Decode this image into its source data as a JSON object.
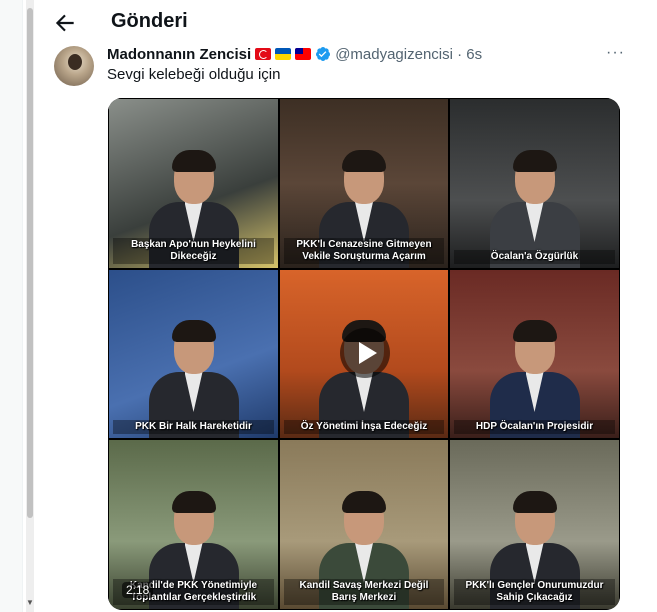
{
  "header": {
    "title": "Gönderi",
    "back_icon": "arrow-left-icon"
  },
  "tweet": {
    "author_name": "Madonnanın Zencisi",
    "flags": [
      "turkey-flag-icon",
      "ukraine-flag-icon",
      "taiwan-flag-icon"
    ],
    "verified_icon": "verified-badge-icon",
    "handle_time": "@madyagizencisi · 6s",
    "more_icon": "more-horizontal-icon",
    "more_label": "···",
    "text": "Sevgi kelebeği olduğu için"
  },
  "media": {
    "duration": "2:18",
    "play_icon": "play-icon",
    "captions": [
      "Başkan Apo'nun Heykelini Dikeceğiz",
      "PKK'lı Cenazesine Gitmeyen Vekile Soruşturma Açarım",
      "Öcalan'a Özgürlük",
      "PKK Bir Halk Hareketidir",
      "Öz Yönetimi İnşa Edeceğiz",
      "HDP Öcalan'ın Projesidir",
      "Kandil'de PKK Yönetimiyle Toplantılar Gerçekleştirdik",
      "Kandil Savaş Merkezi Değil Barış Merkezi",
      "PKK'lı Gençler Onurumuzdur Sahip Çıkacağız"
    ]
  },
  "colors": {
    "text_primary": "#0f1419",
    "text_secondary": "#536471",
    "verified_blue": "#1d9bf0"
  }
}
